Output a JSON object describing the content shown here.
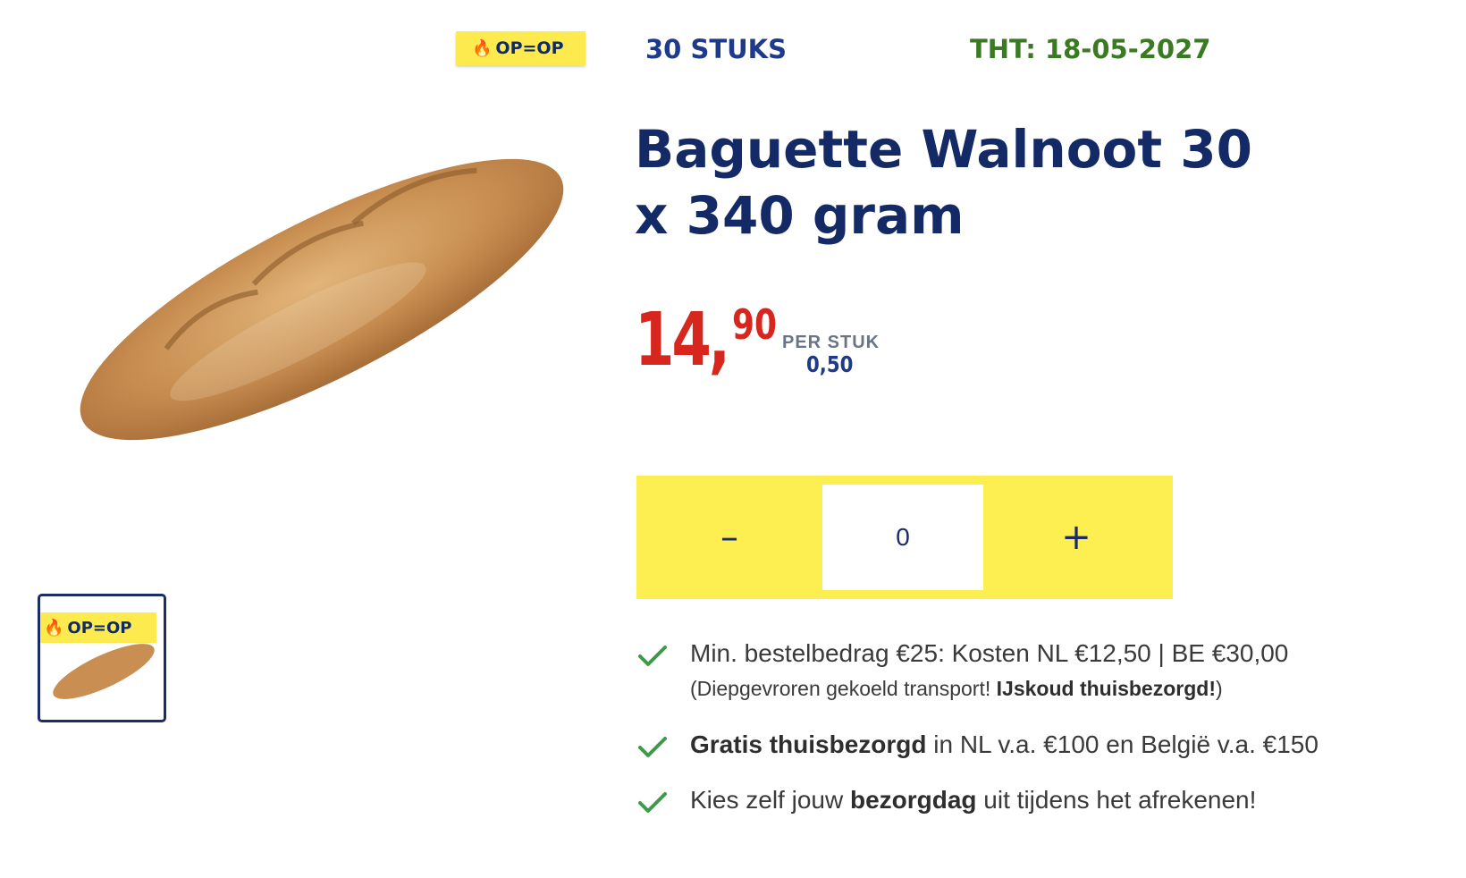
{
  "product": {
    "badge_label": "OP=OP",
    "badge_icon": "flame-icon",
    "quantity_label": "30 STUKS",
    "best_before": "THT: 18-05-2027",
    "title": "Baguette Walnoot 30 x 340 gram",
    "price_int": "14,",
    "price_dec": "90",
    "per_unit_label": "PER STUK",
    "per_unit_price": "0,50"
  },
  "stepper": {
    "minus_label": "–",
    "plus_label": "+",
    "value": "0"
  },
  "benefits": [
    {
      "main_prefix": "Min. bestelbedrag €25: Kosten NL €12,50 | BE €30,00",
      "sub_prefix": "(Diepgevroren gekoeld transport! ",
      "sub_bold": "IJskoud thuisbezorgd!",
      "sub_suffix": ")"
    },
    {
      "bold": "Gratis thuisbezorgd",
      "suffix": " in NL v.a. €100 en België v.a. €150"
    },
    {
      "prefix": "Kies zelf jouw ",
      "bold": "bezorgdag",
      "suffix": " uit tijdens het afrekenen!"
    }
  ],
  "colors": {
    "accent_yellow": "#fdef52",
    "title_navy": "#132a66",
    "price_red": "#d7261e",
    "tht_green": "#3a7a22",
    "check_green": "#3e9a4a"
  }
}
